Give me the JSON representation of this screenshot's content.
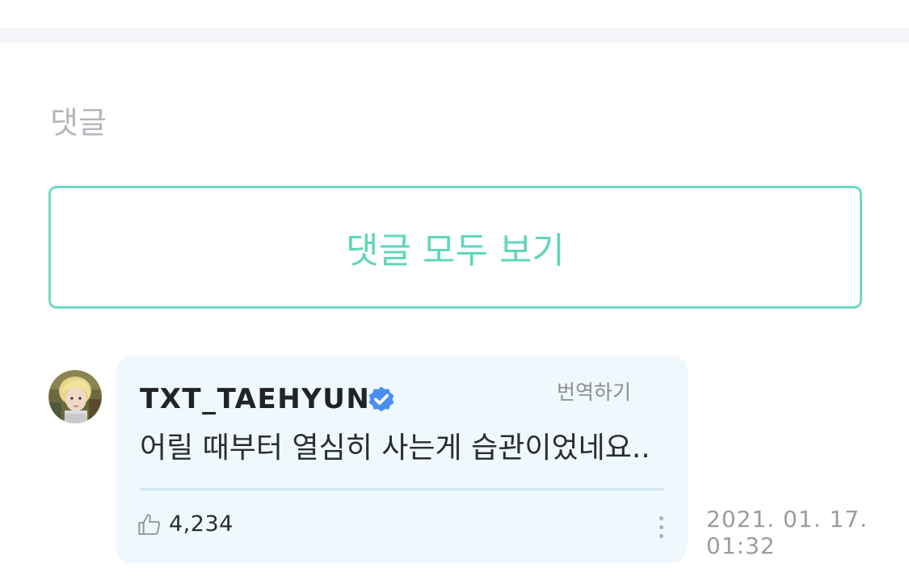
{
  "comments_section": {
    "title": "댓글",
    "view_all_label": "댓글 모두 보기"
  },
  "comment": {
    "username": "TXT_TAEHYUN",
    "verified": true,
    "translate_label": "번역하기",
    "text": "어릴 때부터 열심히 사는게 습관이었네요..",
    "like_count": "4,234",
    "date": "2021. 01. 17.",
    "time": "01:32"
  },
  "colors": {
    "accent": "#5fd7b9",
    "bubble_background": "#eff8fd",
    "verified_badge": "#4a8ff0"
  },
  "icons": {
    "verified": "verified-check-icon",
    "like": "thumbs-up-icon",
    "more": "more-vertical-icon"
  }
}
